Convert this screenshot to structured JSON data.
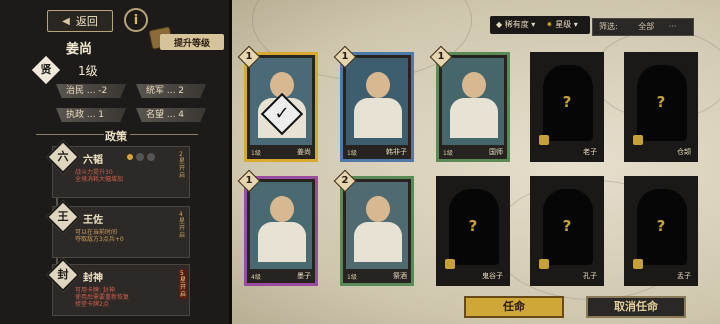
{
  "header": {
    "back_label": "返回",
    "info_icon": "info-icon",
    "upgrade_label": "提升等级"
  },
  "hero": {
    "name": "姜尚",
    "rank_char": "贤",
    "level": "1级",
    "stats": [
      {
        "label": "治民 ... -2"
      },
      {
        "label": "统军 ... 2"
      },
      {
        "label": "执政 ... 1"
      },
      {
        "label": "名望 ... 4"
      }
    ]
  },
  "policies": {
    "title": "政策",
    "items": [
      {
        "icon_char": "六",
        "name": "六韬",
        "desc_line1": "战斗力提升30",
        "desc_line2": "全境消耗大幅增加",
        "lock_text": "2星开启",
        "desc_color": "red"
      },
      {
        "icon_char": "王",
        "name": "王佐",
        "desc_line1": "可以在当前时间",
        "desc_line2": "夺取敌方3点兵+0",
        "lock_text": "4星开启",
        "desc_color": "gold"
      },
      {
        "icon_char": "封",
        "name": "封神",
        "desc_line1": "可用卡牌: 封神",
        "desc_line2": "使用后需要重新恢复",
        "desc_line3": "修堂卡牌2点",
        "lock_text": "5星开启",
        "desc_color": "red"
      }
    ]
  },
  "filter": {
    "rarity_label": "稀有度",
    "star_label": "星级",
    "select_prefix": "筛选:",
    "select_value": "全部"
  },
  "cards": [
    {
      "name": "姜尚",
      "level": "1级",
      "star": "1",
      "border": "yellow",
      "locked": false,
      "selected": true
    },
    {
      "name": "韩非子",
      "level": "1级",
      "star": "1",
      "border": "blue",
      "locked": false,
      "selected": false
    },
    {
      "name": "国师",
      "level": "1级",
      "star": "1",
      "border": "green",
      "locked": false,
      "selected": false
    },
    {
      "name": "老子",
      "level": "",
      "star": "",
      "border": "locked",
      "locked": true,
      "selected": false
    },
    {
      "name": "仓颉",
      "level": "",
      "star": "",
      "border": "locked",
      "locked": true,
      "selected": false
    },
    {
      "name": "墨子",
      "level": "4级",
      "star": "1",
      "border": "purple",
      "locked": false,
      "selected": false
    },
    {
      "name": "祭酒",
      "level": "1级",
      "star": "2",
      "border": "green",
      "locked": false,
      "selected": false
    },
    {
      "name": "鬼谷子",
      "level": "",
      "star": "",
      "border": "locked",
      "locked": true,
      "selected": false
    },
    {
      "name": "孔子",
      "level": "",
      "star": "",
      "border": "locked",
      "locked": true,
      "selected": false
    },
    {
      "name": "孟子",
      "level": "",
      "star": "",
      "border": "locked",
      "locked": true,
      "selected": false
    }
  ],
  "actions": {
    "appoint_label": "任命",
    "cancel_label": "取消任命"
  },
  "colors": {
    "yellow": "#d8a830",
    "blue": "#4d7aa8",
    "green": "#5a8a56",
    "purple": "#9a4ca0",
    "gold_button": "#cfa638"
  }
}
